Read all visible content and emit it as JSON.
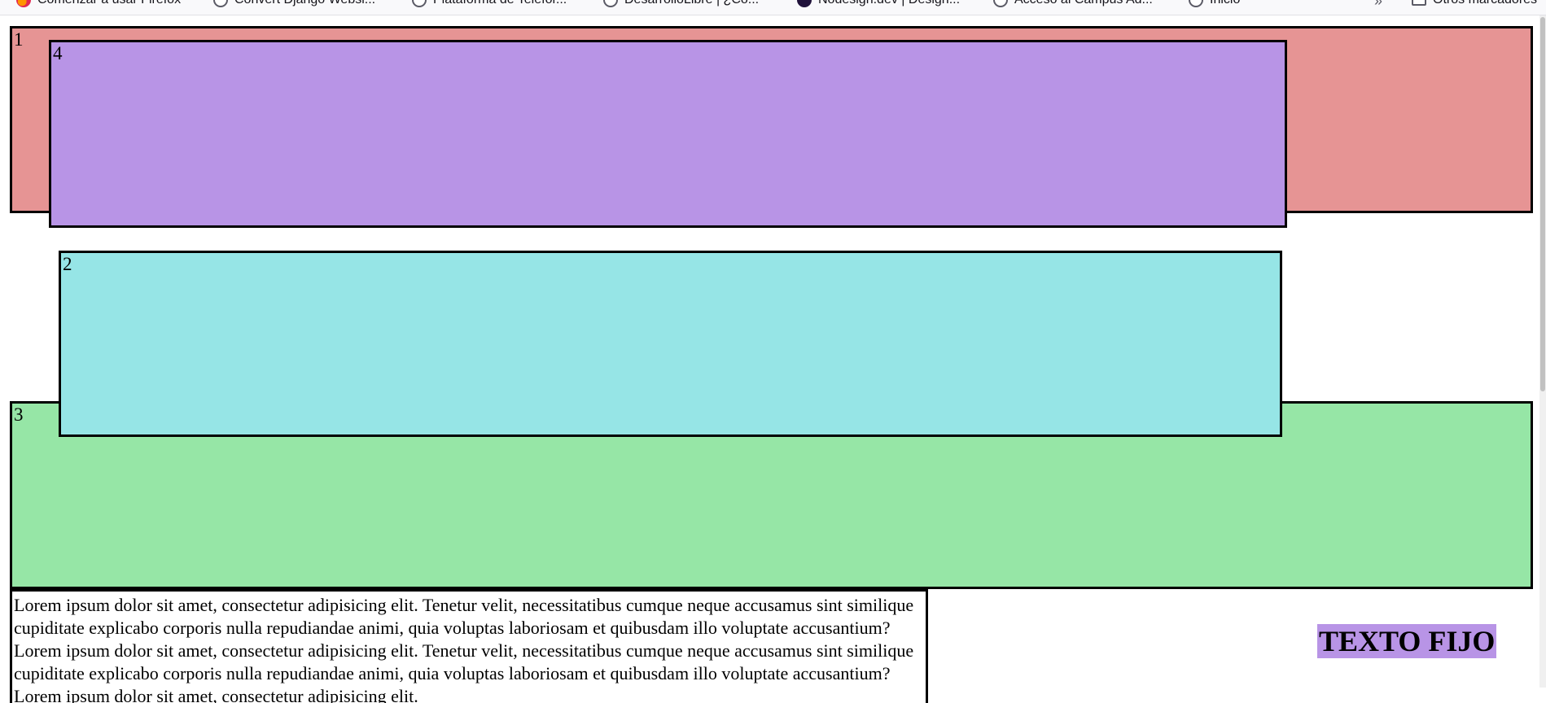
{
  "bookmarks": {
    "items": [
      {
        "label": "Comenzar a usar Firefox",
        "icon": "firefox-icon"
      },
      {
        "label": "Convert Django Websi...",
        "icon": "globe-icon"
      },
      {
        "label": "Plataforma de Telefor...",
        "icon": "globe-icon"
      },
      {
        "label": "DesarrolloLibre | ¿Co...",
        "icon": "globe-icon"
      },
      {
        "label": "Nodesign.dev | Design...",
        "icon": "nodesign-icon"
      },
      {
        "label": "Acceso al Campus Ad...",
        "icon": "globe-icon"
      },
      {
        "label": "Inicio",
        "icon": "globe-icon"
      }
    ],
    "overflow_icon": "chevron-double-right-icon",
    "other_bookmarks": "Otros marcadores"
  },
  "boxes": {
    "box1": "1",
    "box2": "2",
    "box3": "3",
    "box4": "4"
  },
  "colors": {
    "box1": "#e69494",
    "box2": "#96e5e6",
    "box3": "#96e6a6",
    "box4": "#b894e6",
    "fixed_text_bg": "#b894e6"
  },
  "lorem_text": "Lorem ipsum dolor sit amet, consectetur adipisicing elit. Tenetur velit, necessitatibus cumque neque accusamus sint similique cupiditate explicabo corporis nulla repudiandae animi, quia voluptas laboriosam et quibusdam illo voluptate accusantium? Lorem ipsum dolor sit amet, consectetur adipisicing elit. Tenetur velit, necessitatibus cumque neque accusamus sint similique cupiditate explicabo corporis nulla repudiandae animi, quia voluptas laboriosam et quibusdam illo voluptate accusantium? Lorem ipsum dolor sit amet, consectetur adipisicing elit.",
  "fixed_text": "TEXTO FIJO"
}
